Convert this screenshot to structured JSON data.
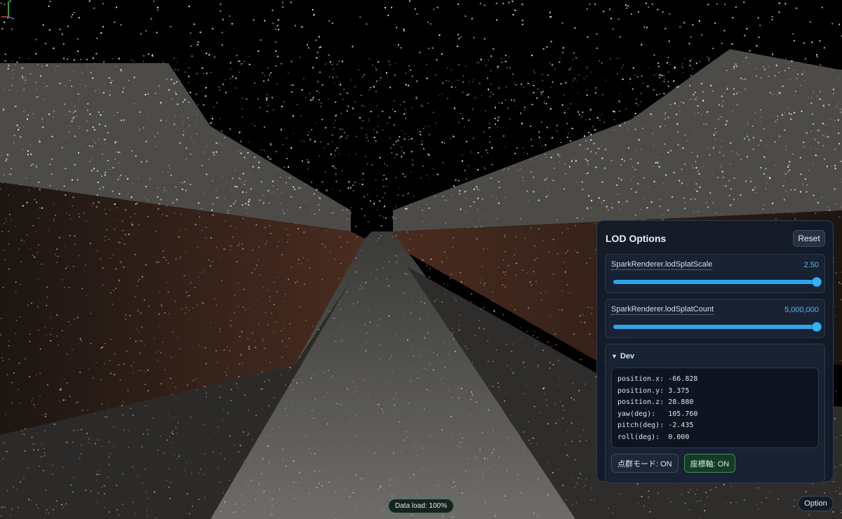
{
  "panel": {
    "title": "LOD Options",
    "reset_label": "Reset"
  },
  "sliders": [
    {
      "label": "SparkRenderer.lodSplatScale",
      "value_text": "2.50",
      "fraction": 1.0
    },
    {
      "label": "SparkRenderer.lodSplatCount",
      "value_text": "5,000,000",
      "fraction": 1.0
    }
  ],
  "dev": {
    "title": "Dev",
    "lines": [
      "position.x: -66.828",
      "position.y: 3.375",
      "position.z: 28.880",
      "yaw(deg):   105.760",
      "pitch(deg): -2.435",
      "roll(deg):  0.000"
    ],
    "point_cloud_toggle": "点群モード: ON",
    "axis_toggle": "座標軸: ON"
  },
  "status": {
    "data_load": "Data load: 100%"
  },
  "option_label": "Option",
  "colors": {
    "accent": "#2fa4ea",
    "panel_bg": "#131b28",
    "toggle_on": "#3c8a5c"
  },
  "icons": {
    "collapse": "triangle-down-icon",
    "gizmo": "axes-gizmo-icon"
  }
}
